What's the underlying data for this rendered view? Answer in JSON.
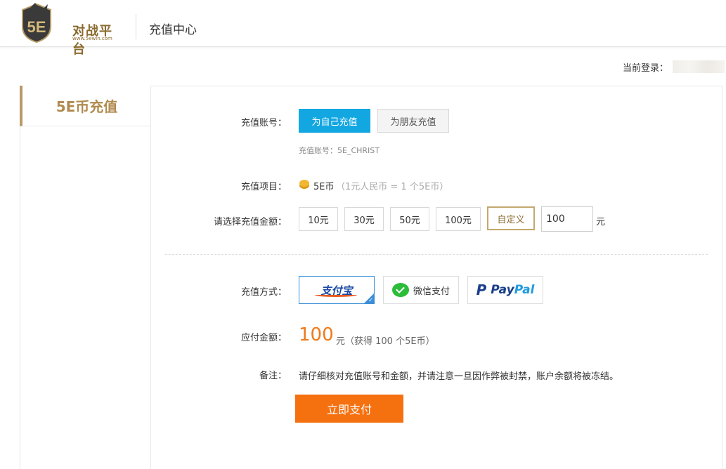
{
  "header": {
    "logo_text": "对战平台",
    "logo_badge": "5E",
    "logo_url": "www.5ewin.com",
    "title": "充值中心"
  },
  "login": {
    "label": "当前登录："
  },
  "sidebar": {
    "items": [
      {
        "label": "5E币充值"
      }
    ]
  },
  "form": {
    "account": {
      "label": "充值账号：",
      "self_button": "为自己充值",
      "friend_button": "为朋友充值",
      "hint": "充值账号：5E_CHRIST"
    },
    "item": {
      "label": "充值项目：",
      "name": "5E币",
      "note": "（1元人民币 = 1 个5E币）"
    },
    "amount": {
      "label": "请选择充值金额：",
      "options": [
        "10元",
        "30元",
        "50元",
        "100元"
      ],
      "custom_button": "自定义",
      "custom_value": "100",
      "unit": "元"
    },
    "method": {
      "label": "充值方式：",
      "alipay": "支付宝",
      "wechat": "微信支付",
      "paypal_a": "Pay",
      "paypal_b": "Pal"
    },
    "due": {
      "label": "应付金额：",
      "value": "100",
      "note": "元（获得 100 个5E币）"
    },
    "remark": {
      "label": "备注：",
      "text": "请仔细核对充值账号和金额，并请注意一旦因作弊被封禁，账户余额将被冻结。"
    },
    "submit": "立即支付"
  },
  "colors": {
    "primary_blue": "#13a7e2",
    "gold": "#b08b4f",
    "orange": "#f5700e"
  }
}
